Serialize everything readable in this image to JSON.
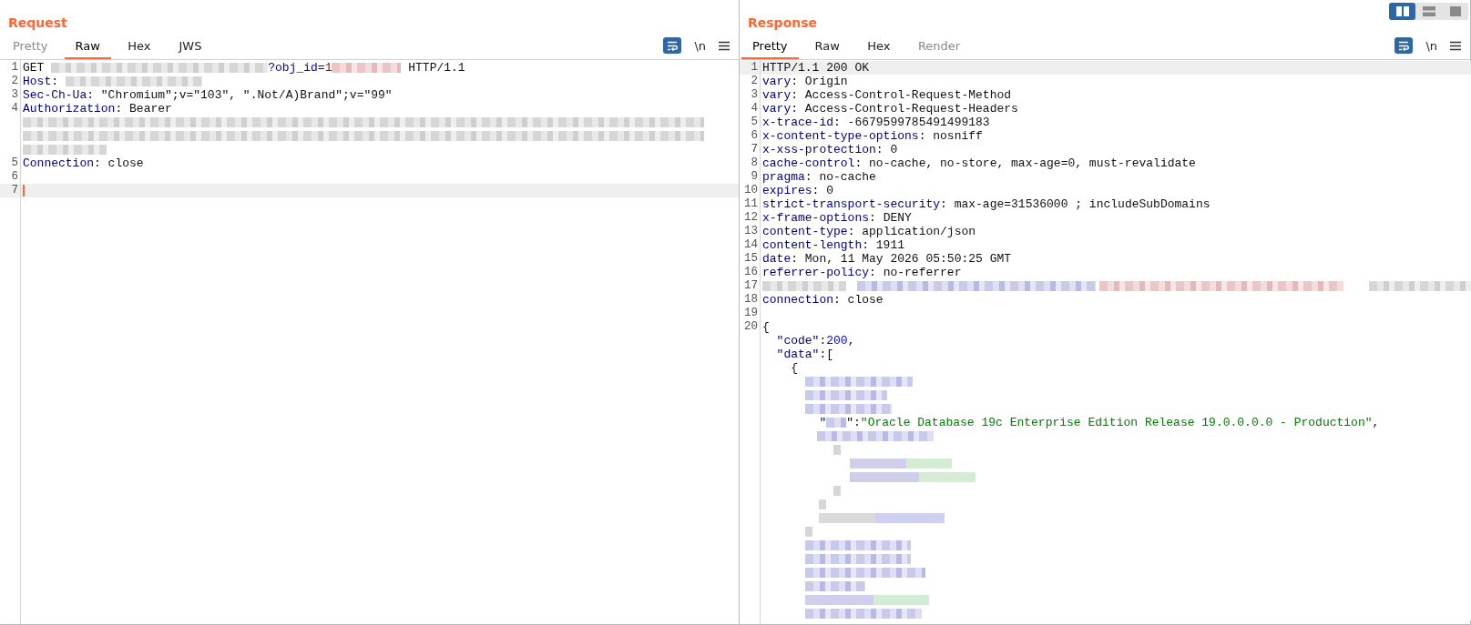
{
  "layout_toggle": [
    {
      "selected": true
    },
    {
      "selected": false
    },
    {
      "selected": false
    }
  ],
  "panes": [
    {
      "title": "Request",
      "tabs": [
        {
          "label": "Pretty",
          "selected": false,
          "disabled": true
        },
        {
          "label": "Raw",
          "selected": true,
          "disabled": false
        },
        {
          "label": "Hex",
          "selected": false,
          "disabled": false
        },
        {
          "label": "JWS",
          "selected": false,
          "disabled": false
        }
      ],
      "toolbar": {
        "newline_label": "\\n"
      },
      "lines": [
        {
          "number": "1",
          "highlighted": false,
          "cursor": false,
          "segments": [
            {
              "kind": "text",
              "text": "GET "
            },
            {
              "kind": "redacted"
            },
            {
              "kind": "param",
              "text": "?obj_id"
            },
            {
              "kind": "text",
              "text": "="
            },
            {
              "kind": "param-value",
              "text": "1"
            },
            {
              "kind": "redacted"
            },
            {
              "kind": "text",
              "text": " HTTP/1.1"
            }
          ]
        },
        {
          "number": "2",
          "highlighted": false,
          "cursor": false,
          "segments": [
            {
              "kind": "key",
              "text": "Host"
            },
            {
              "kind": "text",
              "text": ": "
            },
            {
              "kind": "redacted"
            }
          ]
        },
        {
          "number": "3",
          "highlighted": false,
          "cursor": false,
          "segments": [
            {
              "kind": "key",
              "text": "Sec-Ch-Ua"
            },
            {
              "kind": "text",
              "text": ": \"Chromium\";v=\"103\", \".Not/A)Brand\";v=\"99\""
            }
          ]
        },
        {
          "number": "4",
          "highlighted": false,
          "cursor": false,
          "segments": [
            {
              "kind": "key",
              "text": "Authorization"
            },
            {
              "kind": "text",
              "text": ": Bearer"
            }
          ]
        },
        {
          "highlighted": false,
          "cursor": false,
          "segments": [
            {
              "kind": "redacted"
            }
          ]
        },
        {
          "highlighted": false,
          "cursor": false,
          "segments": [
            {
              "kind": "redacted"
            }
          ]
        },
        {
          "highlighted": false,
          "cursor": false,
          "segments": [
            {
              "kind": "redacted"
            }
          ]
        },
        {
          "number": "5",
          "highlighted": false,
          "cursor": false,
          "segments": [
            {
              "kind": "key",
              "text": "Connection"
            },
            {
              "kind": "text",
              "text": ": close"
            }
          ]
        },
        {
          "number": "6",
          "highlighted": false,
          "cursor": false
        },
        {
          "number": "7",
          "highlighted": true,
          "cursor": true
        }
      ]
    },
    {
      "title": "Response",
      "tabs": [
        {
          "label": "Pretty",
          "selected": true,
          "disabled": false
        },
        {
          "label": "Raw",
          "selected": false,
          "disabled": false
        },
        {
          "label": "Hex",
          "selected": false,
          "disabled": false
        },
        {
          "label": "Render",
          "selected": false,
          "disabled": true
        }
      ],
      "toolbar": {
        "newline_label": "\\n"
      },
      "lines": [
        {
          "number": "1",
          "highlighted": true,
          "cursor": false,
          "segments": [
            {
              "kind": "text",
              "text": "HTTP/1.1 200 OK"
            }
          ]
        },
        {
          "number": "2",
          "highlighted": false,
          "cursor": false,
          "segments": [
            {
              "kind": "key",
              "text": "vary"
            },
            {
              "kind": "text",
              "text": ": Origin"
            }
          ]
        },
        {
          "number": "3",
          "highlighted": false,
          "cursor": false,
          "segments": [
            {
              "kind": "key",
              "text": "vary"
            },
            {
              "kind": "text",
              "text": ": Access-Control-Request-Method"
            }
          ]
        },
        {
          "number": "4",
          "highlighted": false,
          "cursor": false,
          "segments": [
            {
              "kind": "key",
              "text": "vary"
            },
            {
              "kind": "text",
              "text": ": Access-Control-Request-Headers"
            }
          ]
        },
        {
          "number": "5",
          "highlighted": false,
          "cursor": false,
          "segments": [
            {
              "kind": "key",
              "text": "x-trace-id"
            },
            {
              "kind": "text",
              "text": ": -6679599785491499183"
            }
          ]
        },
        {
          "number": "6",
          "highlighted": false,
          "cursor": false,
          "segments": [
            {
              "kind": "key",
              "text": "x-content-type-options"
            },
            {
              "kind": "text",
              "text": ": nosniff"
            }
          ]
        },
        {
          "number": "7",
          "highlighted": false,
          "cursor": false,
          "segments": [
            {
              "kind": "key",
              "text": "x-xss-protection"
            },
            {
              "kind": "text",
              "text": ": 0"
            }
          ]
        },
        {
          "number": "8",
          "highlighted": false,
          "cursor": false,
          "segments": [
            {
              "kind": "key",
              "text": "cache-control"
            },
            {
              "kind": "text",
              "text": ": no-cache, no-store, max-age=0, must-revalidate"
            }
          ]
        },
        {
          "number": "9",
          "highlighted": false,
          "cursor": false,
          "segments": [
            {
              "kind": "key",
              "text": "pragma"
            },
            {
              "kind": "text",
              "text": ": no-cache"
            }
          ]
        },
        {
          "number": "10",
          "highlighted": false,
          "cursor": false,
          "segments": [
            {
              "kind": "key",
              "text": "expires"
            },
            {
              "kind": "text",
              "text": ": 0"
            }
          ]
        },
        {
          "number": "11",
          "highlighted": false,
          "cursor": false,
          "segments": [
            {
              "kind": "key",
              "text": "strict-transport-security"
            },
            {
              "kind": "text",
              "text": ": max-age=31536000 ; includeSubDomains"
            }
          ]
        },
        {
          "number": "12",
          "highlighted": false,
          "cursor": false,
          "segments": [
            {
              "kind": "key",
              "text": "x-frame-options"
            },
            {
              "kind": "text",
              "text": ": DENY"
            }
          ]
        },
        {
          "number": "13",
          "highlighted": false,
          "cursor": false,
          "segments": [
            {
              "kind": "key",
              "text": "content-type"
            },
            {
              "kind": "text",
              "text": ": application/json"
            }
          ]
        },
        {
          "number": "14",
          "highlighted": false,
          "cursor": false,
          "segments": [
            {
              "kind": "key",
              "text": "content-length"
            },
            {
              "kind": "text",
              "text": ": 1911"
            }
          ]
        },
        {
          "number": "15",
          "highlighted": false,
          "cursor": false,
          "segments": [
            {
              "kind": "key",
              "text": "date"
            },
            {
              "kind": "text",
              "text": ": Mon, 11 May 2026 05:50:25 GMT"
            }
          ]
        },
        {
          "number": "16",
          "highlighted": false,
          "cursor": false,
          "segments": [
            {
              "kind": "key",
              "text": "referrer-policy"
            },
            {
              "kind": "text",
              "text": ": no-referrer"
            }
          ]
        },
        {
          "number": "17",
          "highlighted": false,
          "cursor": false,
          "segments": [
            {
              "kind": "redacted"
            },
            {
              "kind": "redacted"
            },
            {
              "kind": "redacted"
            },
            {
              "kind": "redacted"
            }
          ]
        },
        {
          "number": "18",
          "highlighted": false,
          "cursor": false,
          "segments": [
            {
              "kind": "key",
              "text": "connection"
            },
            {
              "kind": "text",
              "text": ": close"
            }
          ]
        },
        {
          "number": "19",
          "highlighted": false,
          "cursor": false
        },
        {
          "number": "20",
          "highlighted": false,
          "cursor": false,
          "segments": [
            {
              "kind": "text",
              "text": "{"
            }
          ]
        },
        {
          "highlighted": false,
          "cursor": false,
          "segments": [
            {
              "kind": "key",
              "text": "  \"code\""
            },
            {
              "kind": "text",
              "text": ":"
            },
            {
              "kind": "number",
              "text": "200"
            },
            {
              "kind": "text",
              "text": ","
            }
          ]
        },
        {
          "highlighted": false,
          "cursor": false,
          "segments": [
            {
              "kind": "key",
              "text": "  \"data\""
            },
            {
              "kind": "text",
              "text": ":["
            }
          ]
        },
        {
          "highlighted": false,
          "cursor": false,
          "segments": [
            {
              "kind": "text",
              "text": "    {"
            }
          ]
        },
        {
          "highlighted": false,
          "cursor": false,
          "segments": [
            {
              "kind": "redacted"
            }
          ]
        },
        {
          "highlighted": false,
          "cursor": false,
          "segments": [
            {
              "kind": "redacted"
            }
          ]
        },
        {
          "highlighted": false,
          "cursor": false,
          "segments": [
            {
              "kind": "redacted"
            }
          ]
        },
        {
          "highlighted": false,
          "cursor": false,
          "segments": [
            {
              "kind": "key",
              "text": "        \""
            },
            {
              "kind": "redacted"
            },
            {
              "kind": "text",
              "text": "\":"
            },
            {
              "kind": "string",
              "text": "\"Oracle Database 19c Enterprise Edition Release 19.0.0.0.0 - Production\""
            },
            {
              "kind": "text",
              "text": ","
            }
          ]
        },
        {
          "highlighted": false,
          "cursor": false,
          "segments": [
            {
              "kind": "redacted"
            }
          ]
        },
        {
          "highlighted": false,
          "cursor": false,
          "segments": [
            {
              "kind": "redacted"
            }
          ]
        },
        {
          "highlighted": false,
          "cursor": false,
          "segments": [
            {
              "kind": "redacted"
            }
          ]
        },
        {
          "highlighted": false,
          "cursor": false,
          "segments": [
            {
              "kind": "redacted"
            }
          ]
        },
        {
          "highlighted": false,
          "cursor": false,
          "segments": [
            {
              "kind": "redacted"
            }
          ]
        },
        {
          "highlighted": false,
          "cursor": false,
          "segments": [
            {
              "kind": "redacted"
            }
          ]
        },
        {
          "highlighted": false,
          "cursor": false,
          "segments": [
            {
              "kind": "redacted"
            }
          ]
        },
        {
          "highlighted": false,
          "cursor": false,
          "segments": [
            {
              "kind": "redacted"
            }
          ]
        },
        {
          "highlighted": false,
          "cursor": false,
          "segments": [
            {
              "kind": "redacted"
            }
          ]
        },
        {
          "highlighted": false,
          "cursor": false,
          "segments": [
            {
              "kind": "redacted"
            }
          ]
        },
        {
          "highlighted": false,
          "cursor": false,
          "segments": [
            {
              "kind": "redacted"
            }
          ]
        },
        {
          "highlighted": false,
          "cursor": false,
          "segments": [
            {
              "kind": "redacted"
            }
          ]
        },
        {
          "highlighted": false,
          "cursor": false,
          "segments": [
            {
              "kind": "redacted"
            }
          ]
        },
        {
          "highlighted": false,
          "cursor": false,
          "segments": [
            {
              "kind": "redacted"
            }
          ]
        }
      ]
    }
  ]
}
